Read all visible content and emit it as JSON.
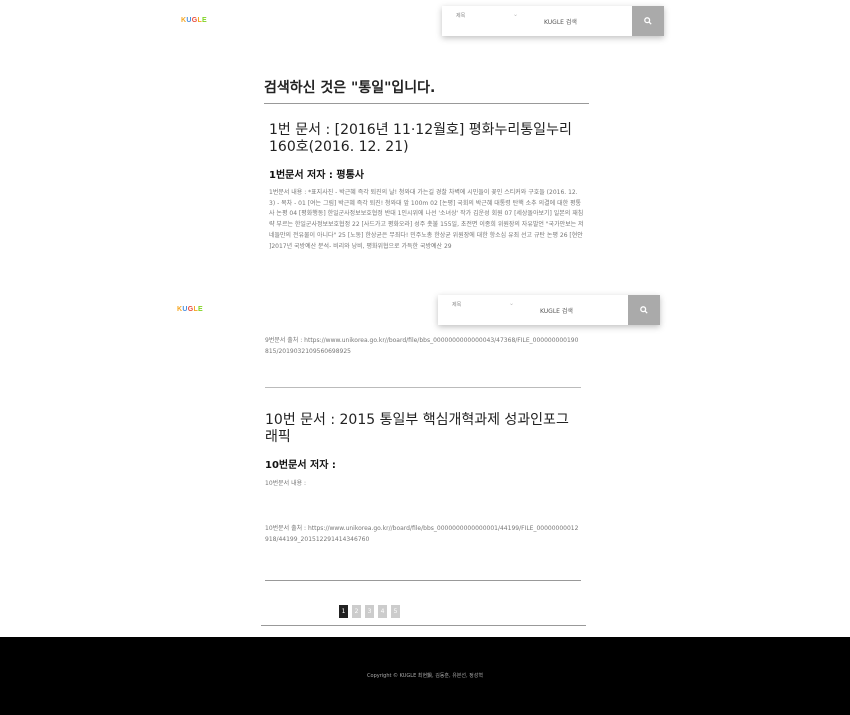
{
  "header": {
    "logo": [
      "K",
      "U",
      "G",
      "L",
      "E"
    ],
    "logo_colors": [
      "#f5a623",
      "#4a90e2",
      "#e94b3c",
      "#f5a623",
      "#7ed321"
    ],
    "select_label": "제목",
    "search_placeholder": "KUGLE 검색"
  },
  "result_heading": "검색하신 것은 \"통일\"입니다.",
  "docs": [
    {
      "title": "1번 문서 : [2016년 11·12월호] 평화누리통일누리 160호(2016. 12. 21)",
      "author": "1번문서 저자 : 평통사",
      "content": "1번문서 내용 : *표지사진 - 박근혜 즉각 퇴진의 날! 청와대 가는길 경찰 차벽에 시민들이 꽃인 스티커와 구호들 (2016. 12. 3) - 목차 - 01 [여는 그림] 박근혜 즉각 퇴진! 청와대 앞 100m 02 [논평] 국회의 박근혜 대통령 탄핵 소추 의결에 대한 평통사 논평 04 [평화행동] 한일군사정보보호협정 반대 1인시위에 나선 '소녀상' 작가 김운성 회원 07 [세상돌아보기] 일본의 재침략 부르는 한일군사정보보호협정 22 [사드가고 평화오라] 성주 촛불 155일, 초전면 이종희 위원장의 자유발언 \"국가안보는 저네들만의 전유물이 아니다\" 25 [노동] 한상균은 무죄다! 민주노총 한상균 위원장에 대한 항소심 유죄 선고 규탄 논평 26 [현안 ]2017년 국방예산 분석- 비리와 낭비, 평화위협으로 가득한 국방예산 29"
    },
    {
      "source": "9번문서 출처 : https://www.unikorea.go.kr//board/file/bbs_0000000000000043/47368/FILE_000000000190815/2019032109560698925"
    },
    {
      "title": "10번 문서 : 2015 통일부 핵심개혁과제 성과인포그래픽",
      "author": "10번문서 저자 :",
      "content": "10번문서 내용 :",
      "source": "10번문서 출처 : https://www.unikorea.go.kr//board/file/bbs_0000000000000001/44199/FILE_00000000012918/44199_20151229141434676​0"
    }
  ],
  "pagination": [
    "1",
    "2",
    "3",
    "4",
    "5"
  ],
  "active_page": "1",
  "footer": {
    "copyright": "Copyright © KUGLE 최현鎭, 김동훈, 유본선, 정성혁"
  }
}
